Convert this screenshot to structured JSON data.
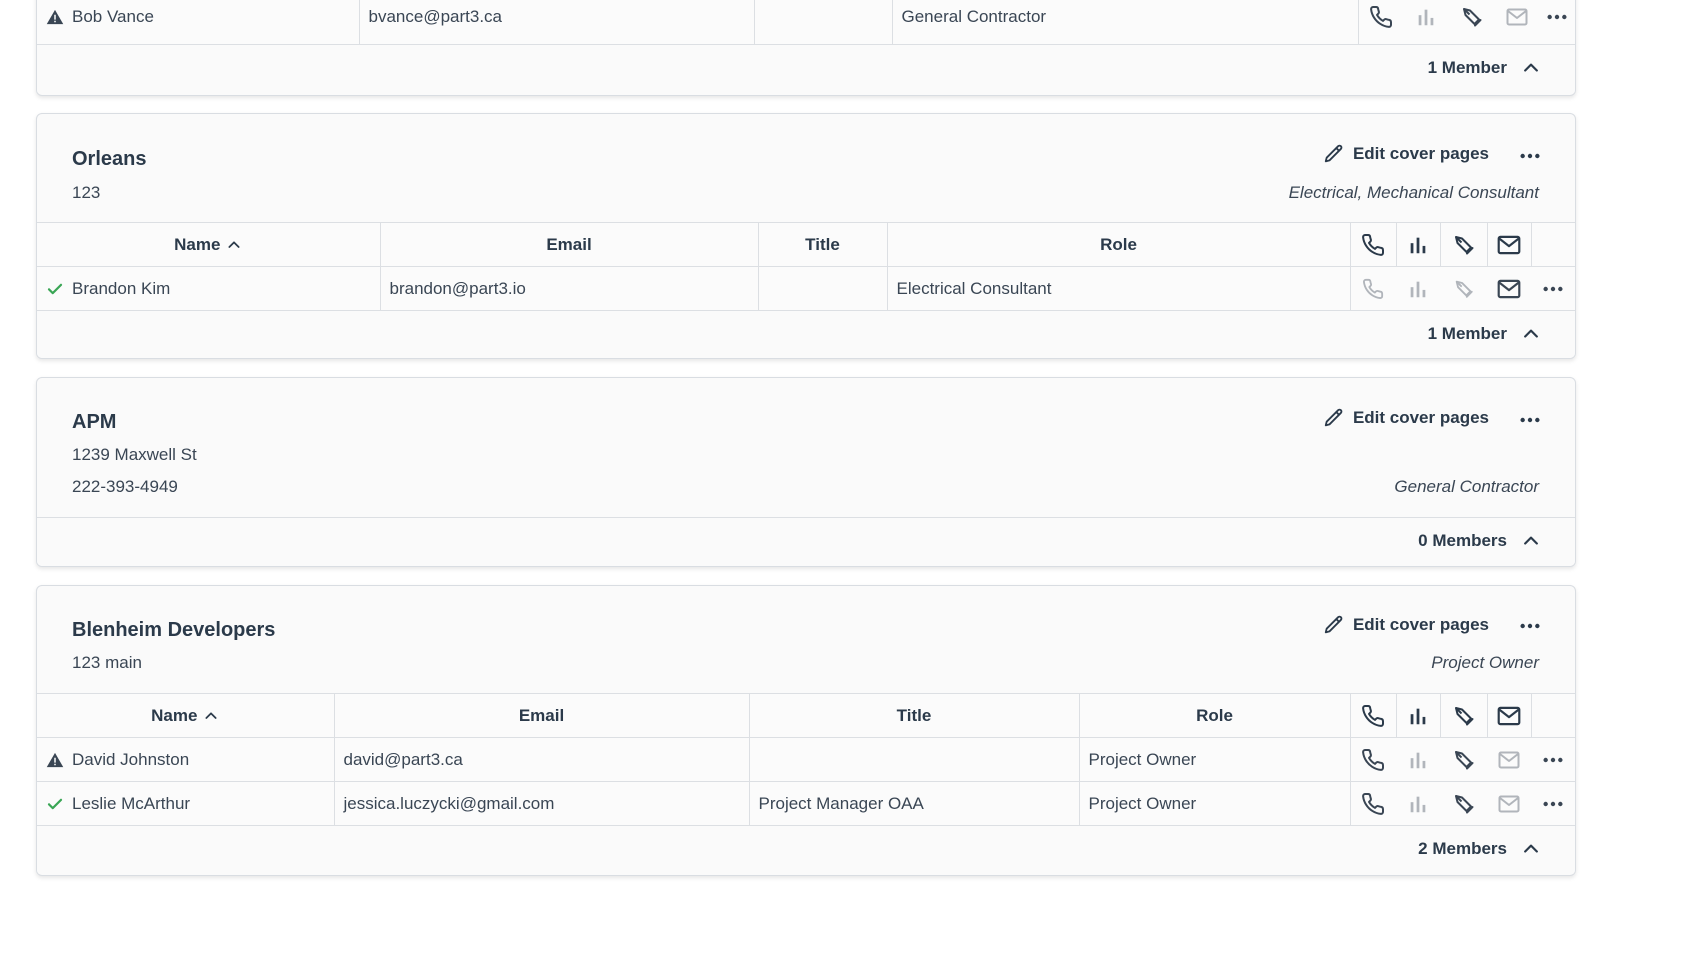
{
  "colors": {
    "text": "#2b3a4a",
    "check": "#3aa655",
    "warning": "#2b3a4a",
    "border": "#dcdfe3"
  },
  "icons": [
    "warning-icon",
    "check-icon",
    "phone-icon",
    "bar-chart-icon",
    "pen-nib-icon",
    "mail-icon",
    "more-dots-icon",
    "pencil-icon",
    "chevron-up-icon",
    "sort-ascending-icon"
  ],
  "card0": {
    "member": {
      "name": "Bob Vance",
      "email": "bvance@part3.ca",
      "title": "",
      "role": "General Contractor",
      "status": "warning"
    },
    "count": "1 Member"
  },
  "card1": {
    "name": "Orleans",
    "line1": "123",
    "role_tag": "Electrical, Mechanical Consultant",
    "edit_label": "Edit cover pages",
    "headers": {
      "name": "Name",
      "email": "Email",
      "title": "Title",
      "role": "Role"
    },
    "members": [
      {
        "name": "Brandon Kim",
        "email": "brandon@part3.io",
        "title": "",
        "role": "Electrical Consultant",
        "status": "check"
      }
    ],
    "count": "1 Member"
  },
  "card2": {
    "name": "APM",
    "line1": "1239 Maxwell St",
    "line2": "222-393-4949",
    "role_tag": "General Contractor",
    "edit_label": "Edit cover pages",
    "count": "0 Members"
  },
  "card3": {
    "name": "Blenheim Developers",
    "line1": "123 main",
    "role_tag": "Project Owner",
    "edit_label": "Edit cover pages",
    "headers": {
      "name": "Name",
      "email": "Email",
      "title": "Title",
      "role": "Role"
    },
    "members": [
      {
        "name": "David Johnston",
        "email": "david@part3.ca",
        "title": "",
        "role": "Project Owner",
        "status": "warning"
      },
      {
        "name": "Leslie McArthur",
        "email": "jessica.luczycki@gmail.com",
        "title": "Project Manager OAA",
        "role": "Project Owner",
        "status": "check"
      }
    ],
    "count": "2 Members"
  }
}
